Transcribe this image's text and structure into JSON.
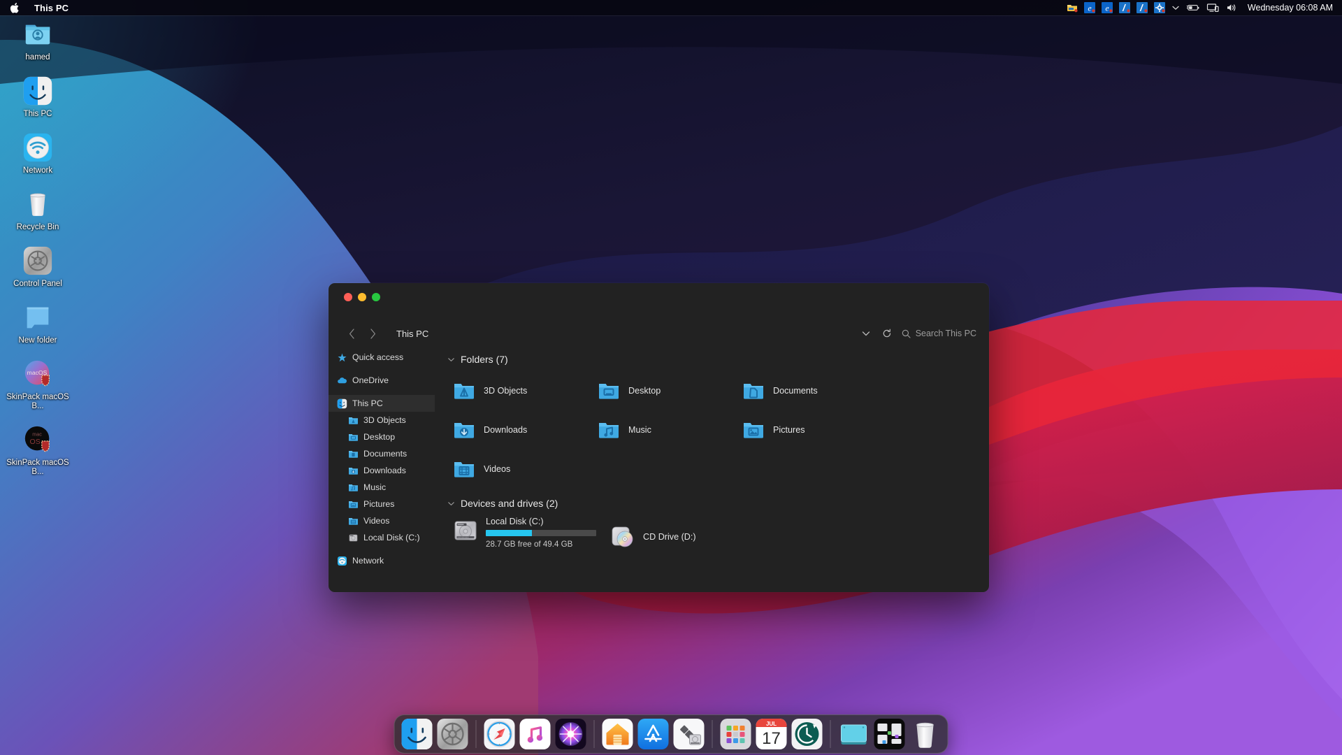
{
  "menubar": {
    "apple_icon": "apple-logo",
    "title": "This PC",
    "tray_icons": [
      {
        "name": "file-explorer-tray-icon"
      },
      {
        "name": "edge-browser-tray-icon"
      },
      {
        "name": "internet-explorer-tray-icon"
      },
      {
        "name": "blue-app-tray-icon-1"
      },
      {
        "name": "blue-app-tray-icon-2"
      },
      {
        "name": "settings-gear-tray-icon"
      },
      {
        "name": "chevron-down-icon"
      },
      {
        "name": "battery-icon"
      },
      {
        "name": "display-icon"
      },
      {
        "name": "volume-icon"
      }
    ],
    "clock": "Wednesday 06:08 AM"
  },
  "desktop_icons": [
    {
      "label": "hamed",
      "icon": "user-folder-icon"
    },
    {
      "label": "This PC",
      "icon": "finder-icon"
    },
    {
      "label": "Network",
      "icon": "network-wifi-icon"
    },
    {
      "label": "Recycle Bin",
      "icon": "trash-icon"
    },
    {
      "label": "Control Panel",
      "icon": "control-panel-gear-icon"
    },
    {
      "label": "New folder",
      "icon": "blue-folder-icon"
    },
    {
      "label": "SkinPack macOS B...",
      "icon": "skinpack-installer-icon"
    },
    {
      "label": "SkinPack macOS B...",
      "icon": "skinpack-dark-installer-icon"
    }
  ],
  "explorer": {
    "window_controls": {
      "close": "close-button",
      "minimize": "minimize-button",
      "maximize": "maximize-button"
    },
    "nav": {
      "back": "back-button",
      "forward": "forward-button",
      "breadcrumb": "This PC"
    },
    "toolbar": {
      "dropdown": "chevron-down-icon",
      "refresh": "refresh-icon",
      "search_icon": "search-icon",
      "search_placeholder": "Search This PC"
    },
    "sidebar": [
      {
        "label": "Quick access",
        "icon": "star-icon",
        "level": 0,
        "selected": false
      },
      {
        "label": "OneDrive",
        "icon": "cloud-icon",
        "level": 0,
        "selected": false
      },
      {
        "label": "This PC",
        "icon": "finder-icon",
        "level": 0,
        "selected": true
      },
      {
        "label": "3D Objects",
        "icon": "folder-3d-icon",
        "level": 1,
        "selected": false
      },
      {
        "label": "Desktop",
        "icon": "folder-desktop-icon",
        "level": 1,
        "selected": false
      },
      {
        "label": "Documents",
        "icon": "folder-documents-icon",
        "level": 1,
        "selected": false
      },
      {
        "label": "Downloads",
        "icon": "folder-downloads-icon",
        "level": 1,
        "selected": false
      },
      {
        "label": "Music",
        "icon": "folder-music-icon",
        "level": 1,
        "selected": false
      },
      {
        "label": "Pictures",
        "icon": "folder-pictures-icon",
        "level": 1,
        "selected": false
      },
      {
        "label": "Videos",
        "icon": "folder-videos-icon",
        "level": 1,
        "selected": false
      },
      {
        "label": "Local Disk (C:)",
        "icon": "hard-drive-icon",
        "level": 1,
        "selected": false
      },
      {
        "label": "Network",
        "icon": "network-icon",
        "level": 0,
        "selected": false
      }
    ],
    "groups": [
      {
        "header": "Folders (7)",
        "items": [
          {
            "label": "3D Objects",
            "icon": "folder-3d-icon"
          },
          {
            "label": "Desktop",
            "icon": "folder-desktop-icon"
          },
          {
            "label": "Documents",
            "icon": "folder-documents-icon"
          },
          {
            "label": "Downloads",
            "icon": "folder-downloads-icon"
          },
          {
            "label": "Music",
            "icon": "folder-music-icon"
          },
          {
            "label": "Pictures",
            "icon": "folder-pictures-icon"
          },
          {
            "label": "Videos",
            "icon": "folder-videos-icon"
          }
        ]
      },
      {
        "header": "Devices and drives (2)",
        "drives": [
          {
            "label": "Local Disk (C:)",
            "icon": "hard-drive-icon",
            "free_text": "28.7 GB free of 49.4 GB",
            "used_percent": 42,
            "bar_color": "#26c6f0"
          },
          {
            "label": "CD Drive (D:)",
            "icon": "cd-drive-icon"
          }
        ]
      }
    ]
  },
  "dock": {
    "items": [
      {
        "name": "finder",
        "icon": "finder-icon"
      },
      {
        "name": "system-preferences",
        "icon": "system-preferences-icon"
      },
      {
        "name": "separator-1",
        "icon": "dock-separator"
      },
      {
        "name": "safari",
        "icon": "safari-icon"
      },
      {
        "name": "music",
        "icon": "music-icon"
      },
      {
        "name": "siri",
        "icon": "siri-icon"
      },
      {
        "name": "separator-2",
        "icon": "dock-separator"
      },
      {
        "name": "home",
        "icon": "home-icon"
      },
      {
        "name": "app-store",
        "icon": "app-store-icon"
      },
      {
        "name": "disk-utility",
        "icon": "disk-utility-icon"
      },
      {
        "name": "separator-3",
        "icon": "dock-separator"
      },
      {
        "name": "launchpad",
        "icon": "launchpad-icon"
      },
      {
        "name": "calendar",
        "icon": "calendar-icon"
      },
      {
        "name": "time-machine",
        "icon": "time-machine-icon"
      },
      {
        "name": "separator-4",
        "icon": "dock-separator"
      },
      {
        "name": "downloads-stack",
        "icon": "downloads-stack-icon"
      },
      {
        "name": "mission-control",
        "icon": "mission-control-icon"
      },
      {
        "name": "trash",
        "icon": "trash-icon"
      }
    ],
    "calendar_month": "JUL",
    "calendar_day": "17"
  },
  "colors": {
    "accent_blue": "#4aa8e0",
    "folder_blue": "#3fa9e3",
    "progress_cyan": "#26c6f0",
    "window_bg": "#222222",
    "sidebar_selected": "#2e2e2e"
  }
}
